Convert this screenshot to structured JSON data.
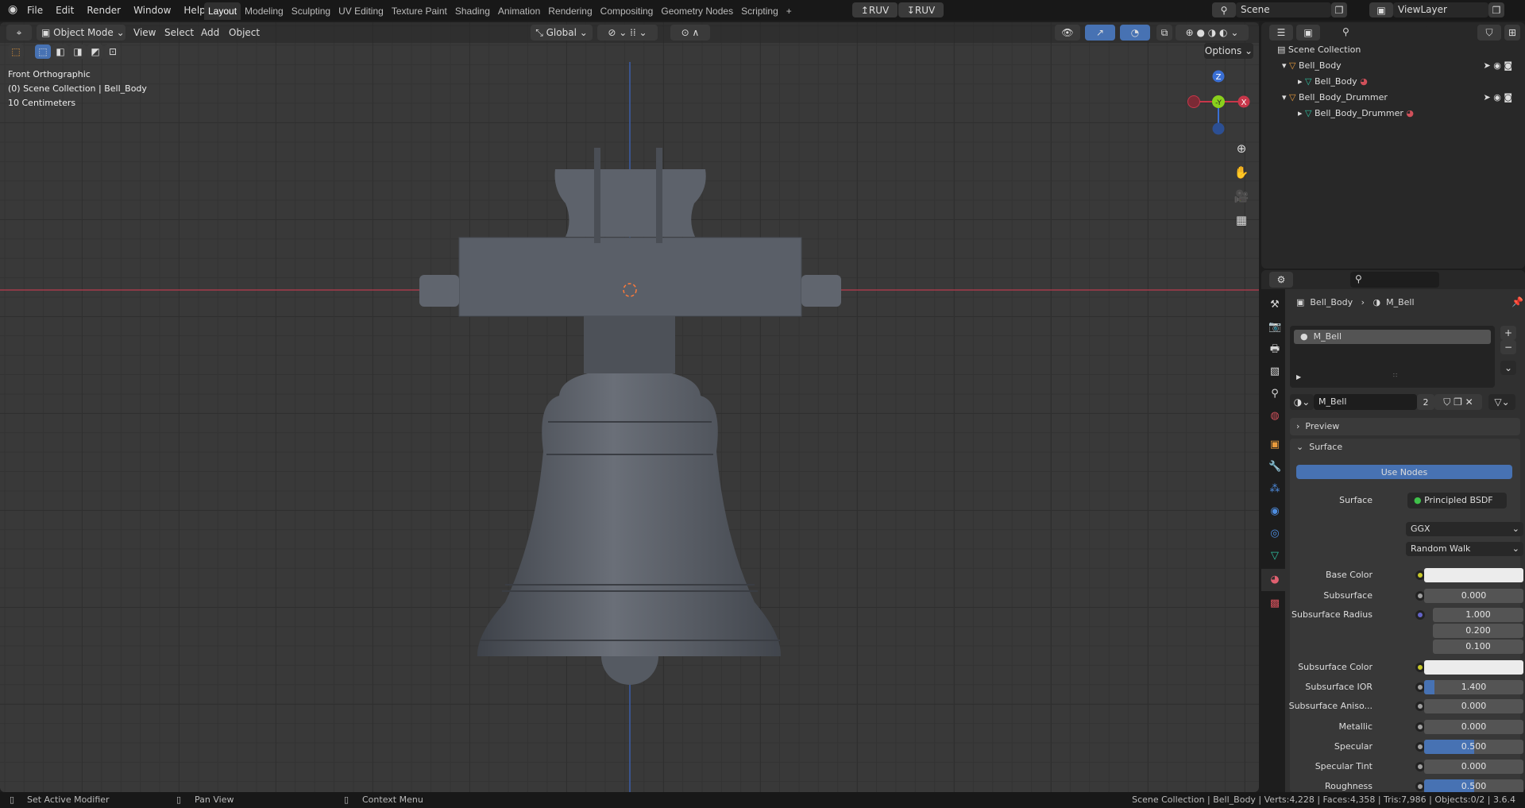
{
  "topbar": {
    "menus": [
      "File",
      "Edit",
      "Render",
      "Window",
      "Help"
    ],
    "workspaces": [
      "Layout",
      "Modeling",
      "Sculpting",
      "UV Editing",
      "Texture Paint",
      "Shading",
      "Animation",
      "Rendering",
      "Compositing",
      "Geometry Nodes",
      "Scripting"
    ],
    "active_workspace": "Layout",
    "add_ws": "+",
    "ruv_up": "RUV",
    "ruv_down": "RUV",
    "scene": "Scene",
    "view_layer": "ViewLayer"
  },
  "viewport": {
    "mode": "Object Mode",
    "menus": [
      "View",
      "Select",
      "Add",
      "Object"
    ],
    "orientation": "Global",
    "options": "Options",
    "overlay_lines": [
      "Front Orthographic",
      "(0) Scene Collection | Bell_Body",
      "10 Centimeters"
    ],
    "gizmo": {
      "z": "Z",
      "y": "-Y",
      "x": "X"
    },
    "colors": {
      "x_axis": "#c8374a",
      "z_axis": "#3a6fd4",
      "y_axis": "#8ad01c",
      "bell": "#5a5f68"
    }
  },
  "outliner": {
    "search_placeholder": "",
    "root": "Scene Collection",
    "items": [
      {
        "name": "Bell_Body",
        "child": "Bell_Body"
      },
      {
        "name": "Bell_Body_Drummer",
        "child": "Bell_Body_Drummer"
      }
    ]
  },
  "properties": {
    "breadcrumb_object": "Bell_Body",
    "breadcrumb_material": "M_Bell",
    "slot": "M_Bell",
    "material_name": "M_Bell",
    "users": "2",
    "preview": "Preview",
    "surface_panel": "Surface",
    "use_nodes": "Use Nodes",
    "surface_label": "Surface",
    "surface_value": "Principled BSDF",
    "distribution": "GGX",
    "subsurface_method": "Random Walk",
    "rows": [
      {
        "label": "Base Color",
        "type": "color",
        "dot": "#c8c82a"
      },
      {
        "label": "Subsurface",
        "value": "0.000",
        "fill": 0,
        "dot": "#a0a0a0"
      },
      {
        "label": "Subsurface Radius",
        "values": [
          "1.000",
          "0.200",
          "0.100"
        ],
        "dot": "#6363c7"
      },
      {
        "label": "Subsurface Color",
        "type": "color",
        "dot": "#c8c82a"
      },
      {
        "label": "Subsurface IOR",
        "value": "1.400",
        "fill": 0.1,
        "dot": "#a0a0a0"
      },
      {
        "label": "Subsurface Aniso...",
        "value": "0.000",
        "fill": 0,
        "dot": "#a0a0a0"
      },
      {
        "label": "Metallic",
        "value": "0.000",
        "fill": 0,
        "dot": "#a0a0a0"
      },
      {
        "label": "Specular",
        "value": "0.500",
        "fill": 0.5,
        "dot": "#a0a0a0"
      },
      {
        "label": "Specular Tint",
        "value": "0.000",
        "fill": 0,
        "dot": "#a0a0a0"
      },
      {
        "label": "Roughness",
        "value": "0.500",
        "fill": 0.5,
        "dot": "#a0a0a0"
      }
    ]
  },
  "status": {
    "left": "Set Active Modifier",
    "middle": "Pan View",
    "right": "Context Menu",
    "stats": "Scene Collection | Bell_Body | Verts:4,228 | Faces:4,358 | Tris:7,986 | Objects:0/2 | 3.6.4"
  }
}
